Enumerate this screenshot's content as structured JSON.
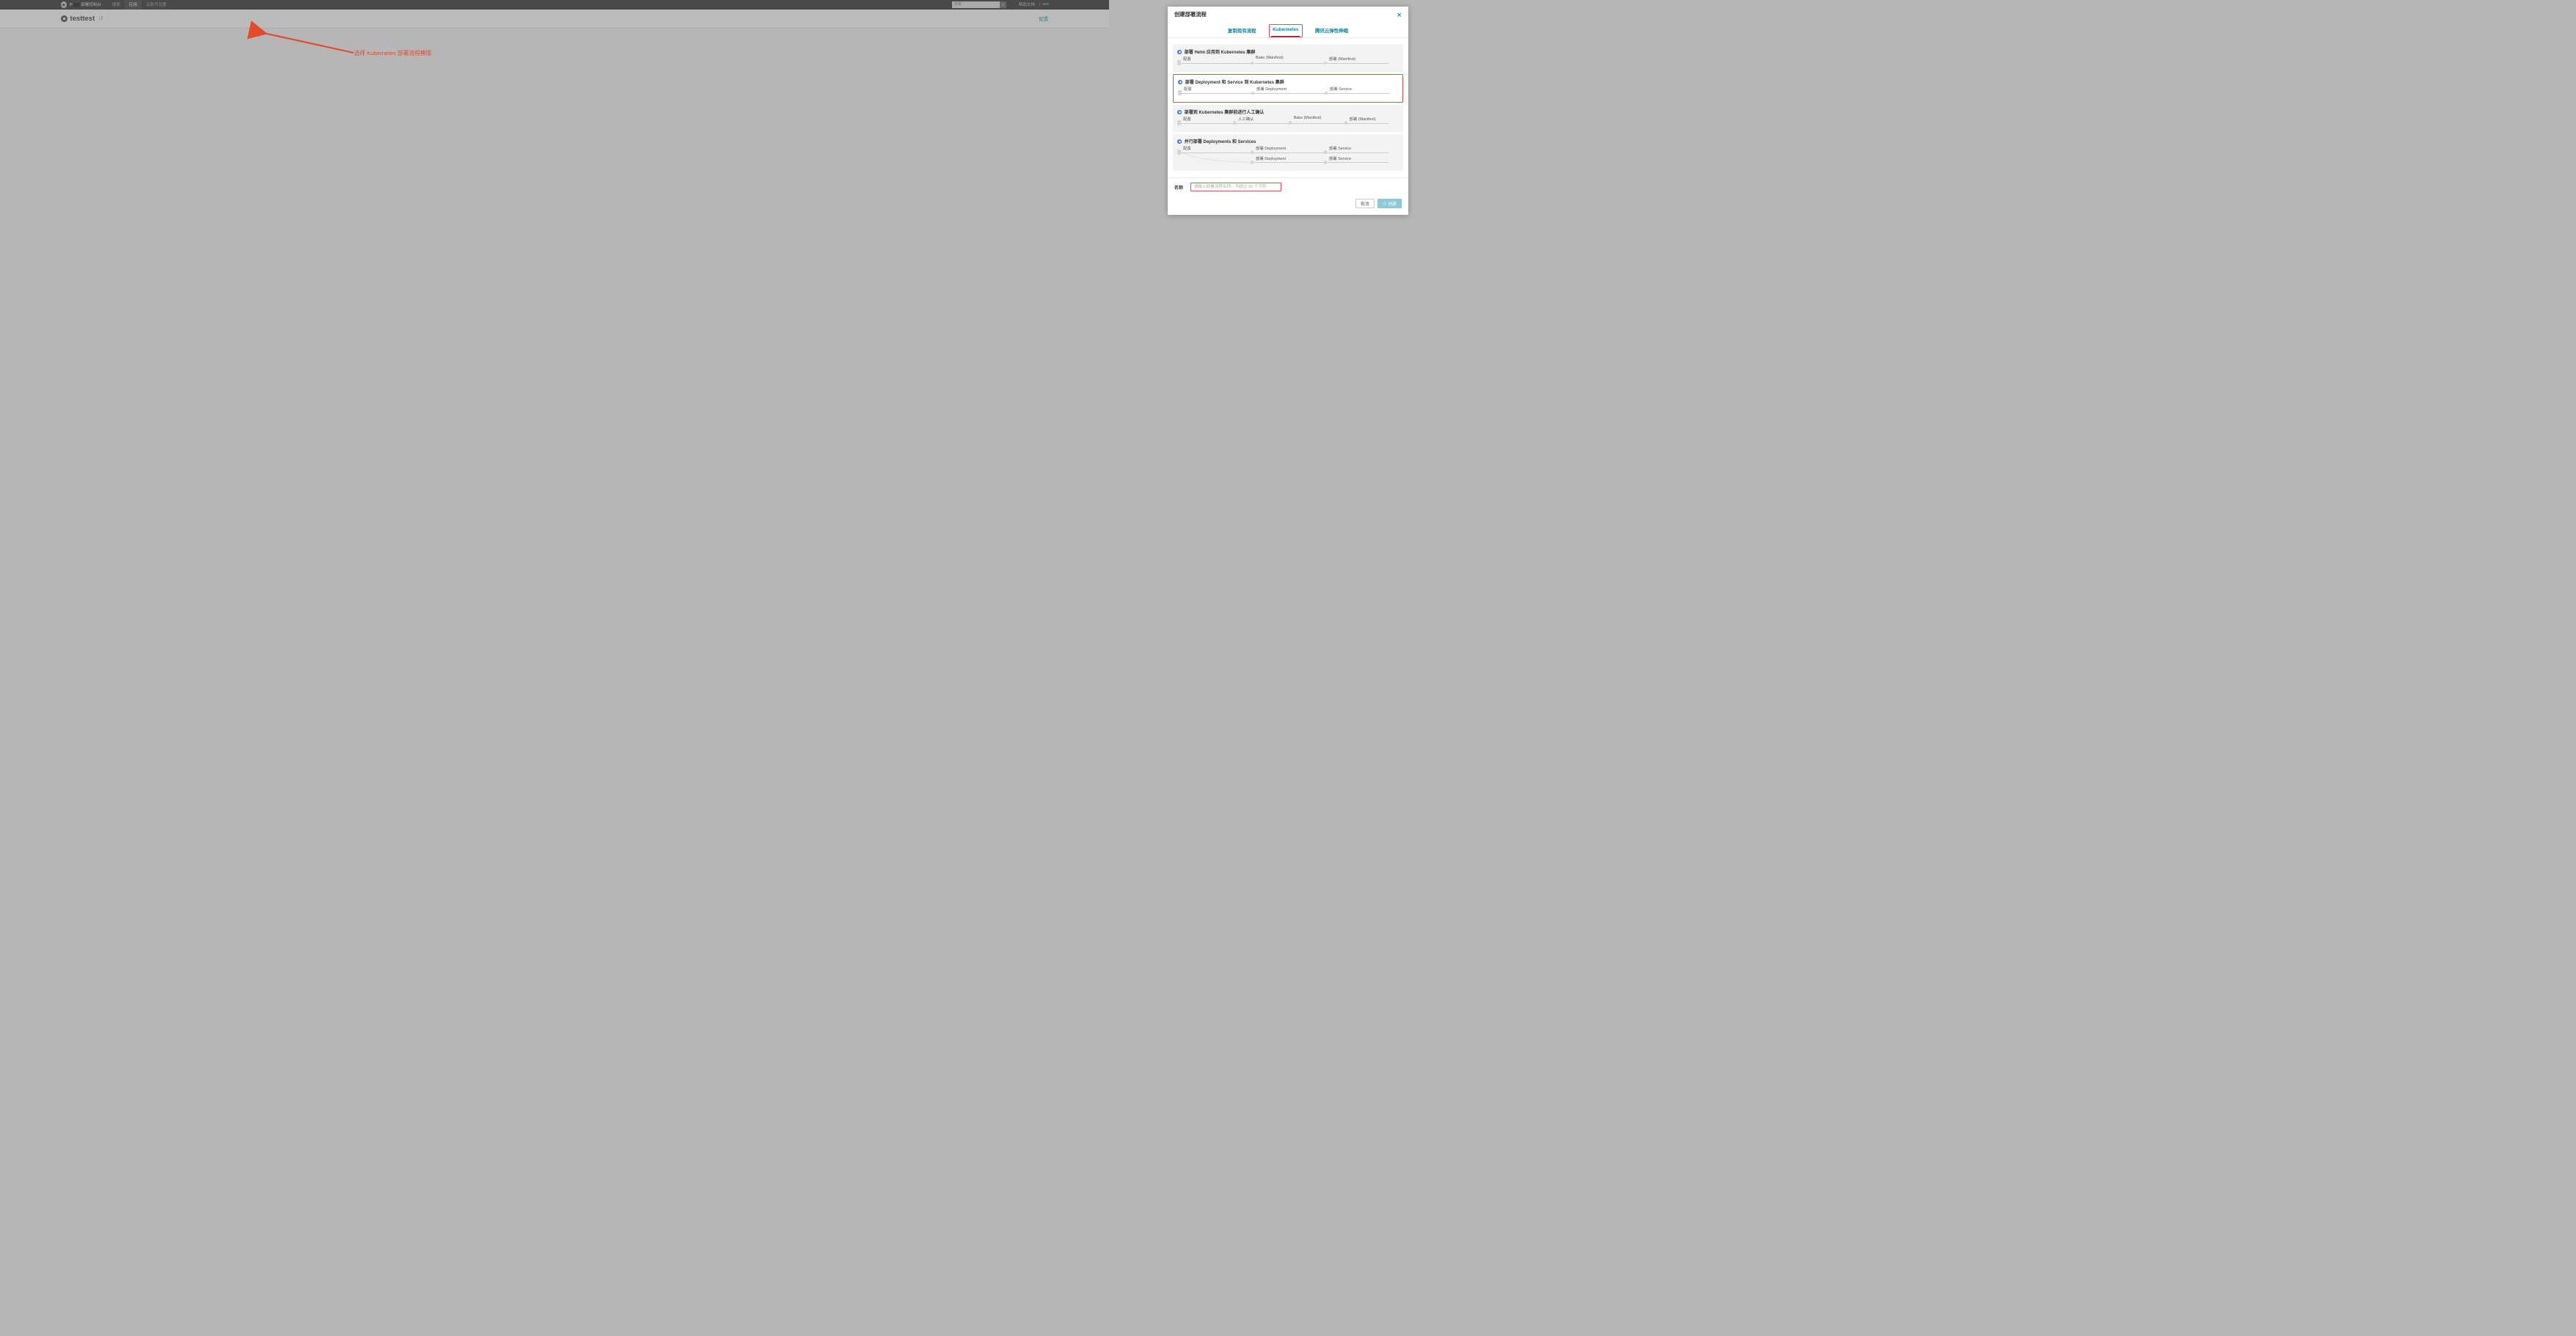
{
  "topnav": {
    "brand_prefix": "je",
    "brand_suffix": "部署控制台",
    "items": [
      "搜索",
      "应用",
      "云账号设置"
    ],
    "active_index": 1,
    "search_placeholder": "搜索",
    "help_label": "帮助文档",
    "user_label": "j"
  },
  "pagehdr": {
    "app_name": "testtest",
    "config_label": "配置"
  },
  "modal": {
    "title": "创建部署流程",
    "tabs": [
      "复制现有流程",
      "Kubernetes",
      "腾讯云弹性伸缩"
    ],
    "active_tab_index": 1,
    "templates": [
      {
        "title": "部署 Helm 应用到 Kubernetes 集群",
        "steps": [
          "配置",
          "Bake (Manifest)",
          "部署 (Manifest)"
        ],
        "selected": false
      },
      {
        "title": "部署 Deployment 和 Service 到 Kubernetes 集群",
        "steps": [
          "配置",
          "部署 Deployment",
          "部署 Service"
        ],
        "selected": true
      },
      {
        "title": "部署到 Kubernetes 集群前进行人工确认",
        "steps": [
          "配置",
          "人工确认",
          "Bake (Manifest)",
          "部署 (Manifest)"
        ],
        "selected": false
      },
      {
        "title": "并行部署 Deployments 和 Services",
        "branches": [
          [
            "配置",
            "部署 Deployment",
            "部署 Service"
          ],
          [
            "",
            "部署 Deployment",
            "部署 Service"
          ]
        ],
        "selected": false
      }
    ],
    "name_label": "名称",
    "name_placeholder": "请输入部署流程名称，不超过 50 个字符",
    "footer": {
      "cancel": "取消",
      "create": "创建"
    }
  },
  "annotation": {
    "text": "选择 Kubernetes 部署流程模版"
  }
}
